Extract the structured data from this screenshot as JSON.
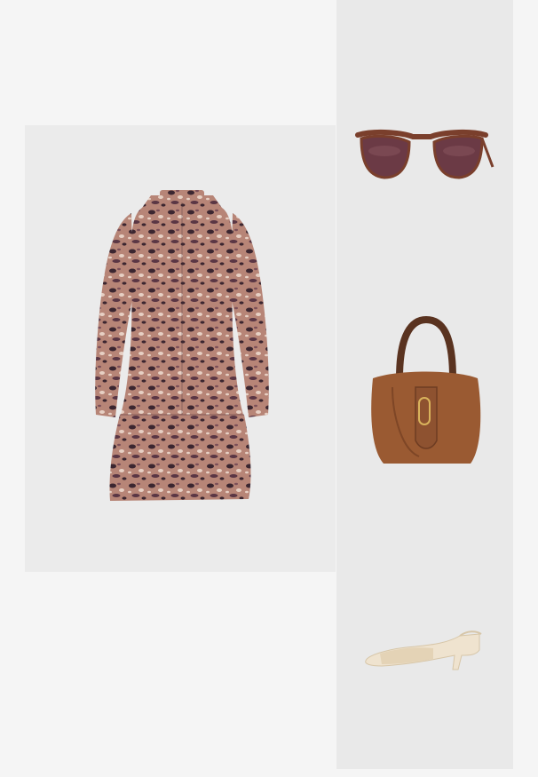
{
  "collage": {
    "items": [
      {
        "type": "dress",
        "pattern": "leopard print",
        "colors": [
          "#3b2630",
          "#b07b6a",
          "#e8cfc3"
        ]
      },
      {
        "type": "sunglasses",
        "frame": "tortoiseshell",
        "lens_color": "#6b3a45"
      },
      {
        "type": "hobo-bag",
        "color": "#9a5a32"
      },
      {
        "type": "slingback-pumps",
        "color": "#efe3cf"
      }
    ],
    "background_colors": {
      "page": "#f5f5f5",
      "panel": "#ebebeb"
    }
  }
}
